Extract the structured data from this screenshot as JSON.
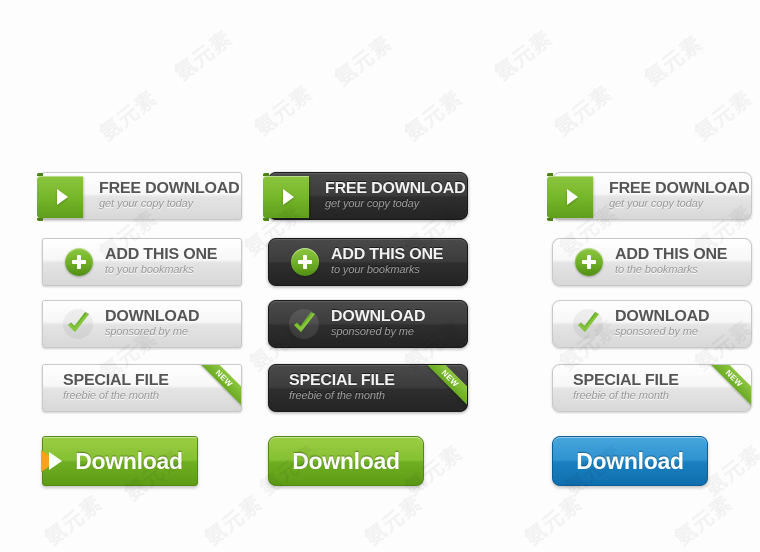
{
  "page": {
    "background": "#fdfdfd",
    "watermark_text": "氨元素",
    "accent_green": "#7cb82f",
    "accent_blue": "#1b80c0",
    "accent_orange": "#f6a318",
    "dark_surface": "#333333",
    "light_surface": "#eeeeee"
  },
  "columns": [
    {
      "id": "column-light-sharp",
      "style": "light",
      "corner": "sharp",
      "buttons": [
        {
          "name": "free-download",
          "title": "FREE DOWNLOAD",
          "subtitle": "get your copy today",
          "icon": "arrow-tab-icon"
        },
        {
          "name": "add-this-one",
          "title": "ADD THIS ONE",
          "subtitle": "to your bookmarks",
          "icon": "plus-circle-icon"
        },
        {
          "name": "download",
          "title": "DOWNLOAD",
          "subtitle": "sponsored by me",
          "icon": "check-icon"
        },
        {
          "name": "special-file",
          "title": "SPECIAL FILE",
          "subtitle": "freebie of the month",
          "icon": "none",
          "ribbon": "NEW"
        }
      ],
      "big_button": {
        "name": "download-big",
        "label": "Download",
        "color": "green",
        "corner": "sharp",
        "arrow": "orange-arrow-icon"
      }
    },
    {
      "id": "column-dark-rounded",
      "style": "dark",
      "corner": "rounded",
      "buttons": [
        {
          "name": "free-download",
          "title": "FREE DOWNLOAD",
          "subtitle": "get your copy today",
          "icon": "arrow-tab-icon"
        },
        {
          "name": "add-this-one",
          "title": "ADD THIS ONE",
          "subtitle": "to your bookmarks",
          "icon": "plus-circle-icon"
        },
        {
          "name": "download",
          "title": "DOWNLOAD",
          "subtitle": "sponsored by me",
          "icon": "check-icon"
        },
        {
          "name": "special-file",
          "title": "SPECIAL FILE",
          "subtitle": "freebie of the month",
          "icon": "none",
          "ribbon": "NEW"
        }
      ],
      "big_button": {
        "name": "download-big",
        "label": "Download",
        "color": "green",
        "corner": "rounded",
        "arrow": "none"
      }
    },
    {
      "id": "column-light-rounded",
      "style": "light",
      "corner": "rounded",
      "buttons": [
        {
          "name": "free-download",
          "title": "FREE DOWNLOAD",
          "subtitle": "get your copy today",
          "icon": "arrow-tab-icon"
        },
        {
          "name": "add-this-one",
          "title": "ADD THIS ONE",
          "subtitle": "to the bookmarks",
          "icon": "plus-circle-icon"
        },
        {
          "name": "download",
          "title": "DOWNLOAD",
          "subtitle": "sponsored by me",
          "icon": "check-icon"
        },
        {
          "name": "special-file",
          "title": "SPECIAL FILE",
          "subtitle": "freebie of the month",
          "icon": "none",
          "ribbon": "NEW"
        }
      ],
      "big_button": {
        "name": "download-big",
        "label": "Download",
        "color": "blue",
        "corner": "rounded",
        "arrow": "none"
      }
    }
  ]
}
